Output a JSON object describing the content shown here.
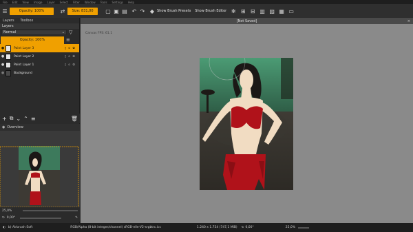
{
  "menu": [
    "File",
    "Edit",
    "View",
    "Image",
    "Layer",
    "Select",
    "Filter",
    "Window",
    "Tools",
    "Settings",
    "Help"
  ],
  "toolbar": {
    "opacity_label": "Opacity: 100%",
    "size_label": "Size: 831,00",
    "brush_presets_label": "Show Brush Presets",
    "brush_editor_label": "Show Brush Editor"
  },
  "left_panel": {
    "tabs": [
      "Layers",
      "Toolbox"
    ],
    "layers_title": "Layers",
    "blend_mode": "Normal",
    "opacity": "Opacity:  100%",
    "layers": [
      {
        "name": "Paint Layer 3",
        "active": true
      },
      {
        "name": "Paint Layer 2",
        "active": false
      },
      {
        "name": "Paint Layer 1",
        "active": false
      },
      {
        "name": "Background",
        "active": false
      }
    ],
    "overview_title": "Overview",
    "zoom_value": "25,0%",
    "rotation_value": "0,00°"
  },
  "document": {
    "tab_title": "[Not Saved]",
    "fps_text": "Canvas FPS: 61.1"
  },
  "status": {
    "brush": "b) Airbrush Soft",
    "color_profile": "RGB/Alpha (8-bit integer/channel)  sRGB-elle-V2-srgbtrc.icc",
    "dimensions": "1.240 x 1.754 (747,1 MiB)",
    "rotation": "0,00°",
    "zoom": "25,0%"
  },
  "colors": {
    "accent": "#f0a000",
    "panel": "#2b2b2b",
    "canvas_bg": "#8a8a8a",
    "skin": "#f1dcc2",
    "clothing": "#b0121a",
    "hair": "#1b1816",
    "sky": "#3d7a5c"
  }
}
